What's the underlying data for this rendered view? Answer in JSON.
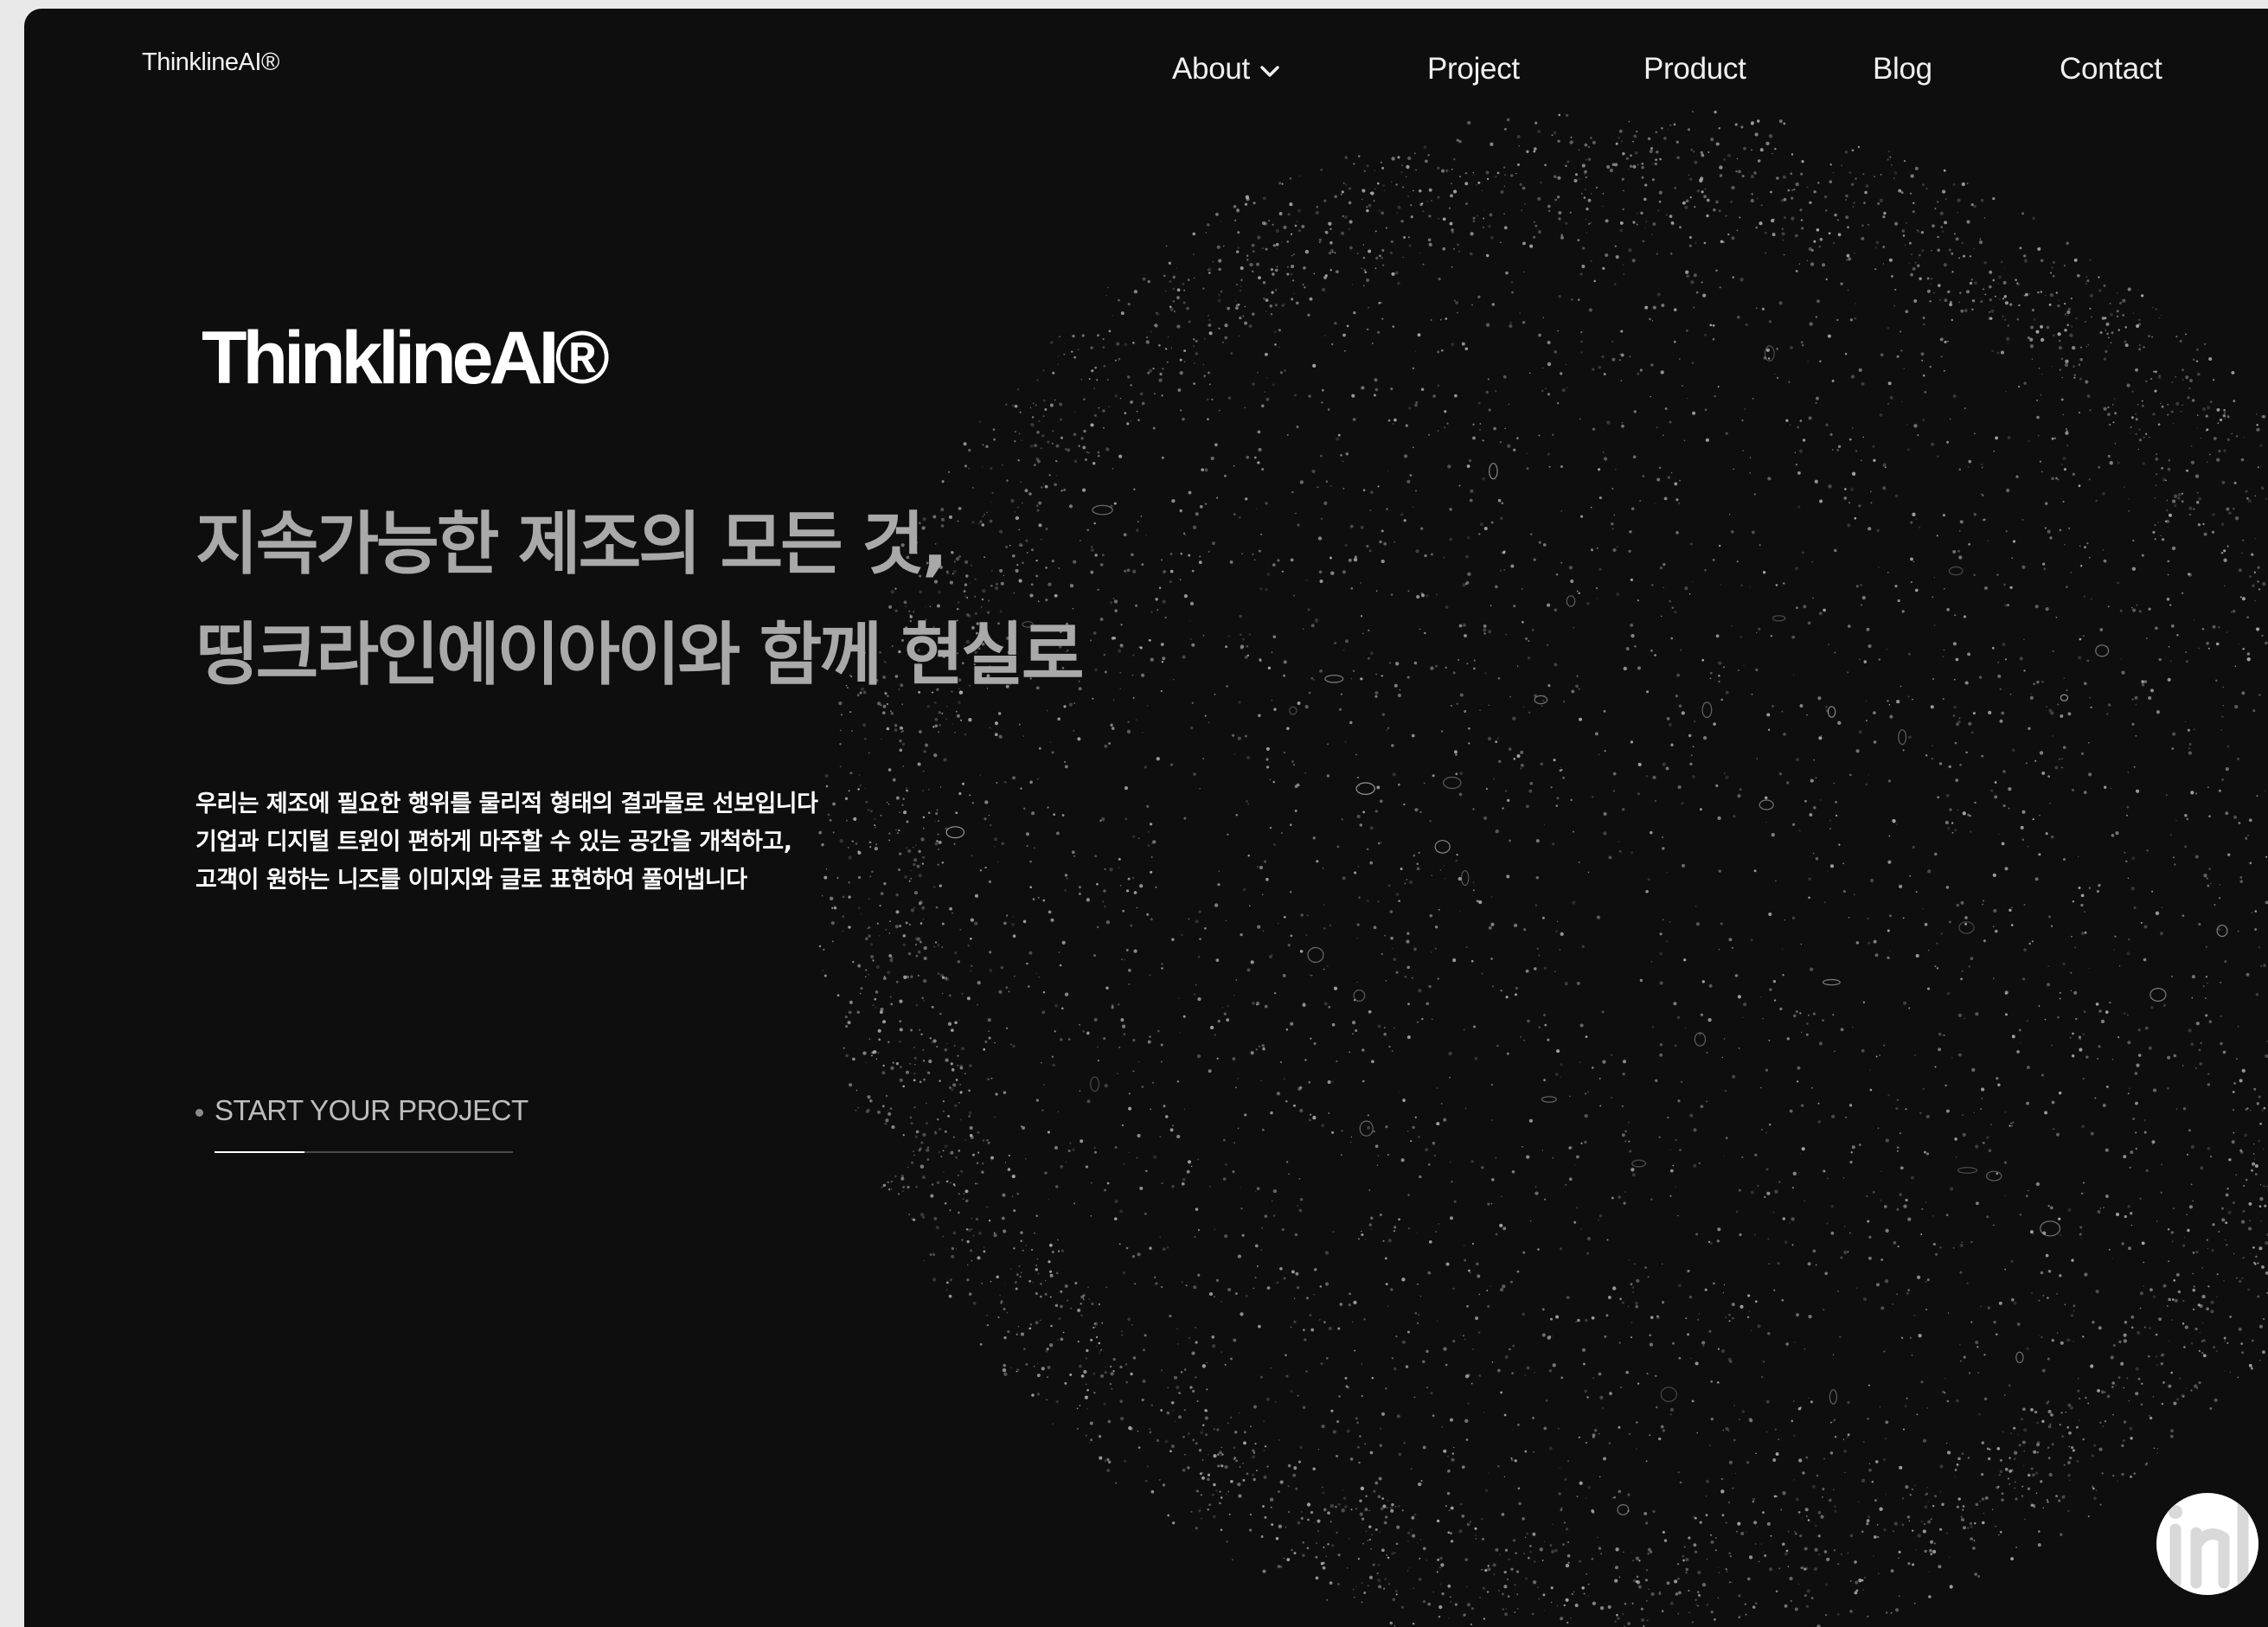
{
  "header": {
    "brand": "ThinklineAI®",
    "nav": [
      {
        "label": "About",
        "has_dropdown": true,
        "icon": "chevron-down-icon"
      },
      {
        "label": "Project"
      },
      {
        "label": "Product"
      },
      {
        "label": "Blog"
      },
      {
        "label": "Contact"
      }
    ]
  },
  "hero": {
    "logo": "ThinklineAI®",
    "headline": [
      "지속가능한 제조의 모든 것,",
      "띵크라인에이아이와 함께 현실로"
    ],
    "description": [
      "우리는 제조에 필요한 행위를 물리적 형태의 결과물로 선보입니다",
      "기업과 디지털 트윈이 편하게 마주할 수 있는 공간을 개척하고,",
      "고객이 원하는 니즈를 이미지와 글로 표현하여 풀어냅니다"
    ],
    "cta": {
      "label": "START YOUR PROJECT",
      "progress": 0.3
    }
  },
  "widget": {
    "icon": "chat-widget-icon"
  },
  "colors": {
    "background": "#0e0e0e",
    "text_primary": "#ffffff",
    "headline": "#a9a9a9",
    "particles": "#bdbdbd"
  }
}
